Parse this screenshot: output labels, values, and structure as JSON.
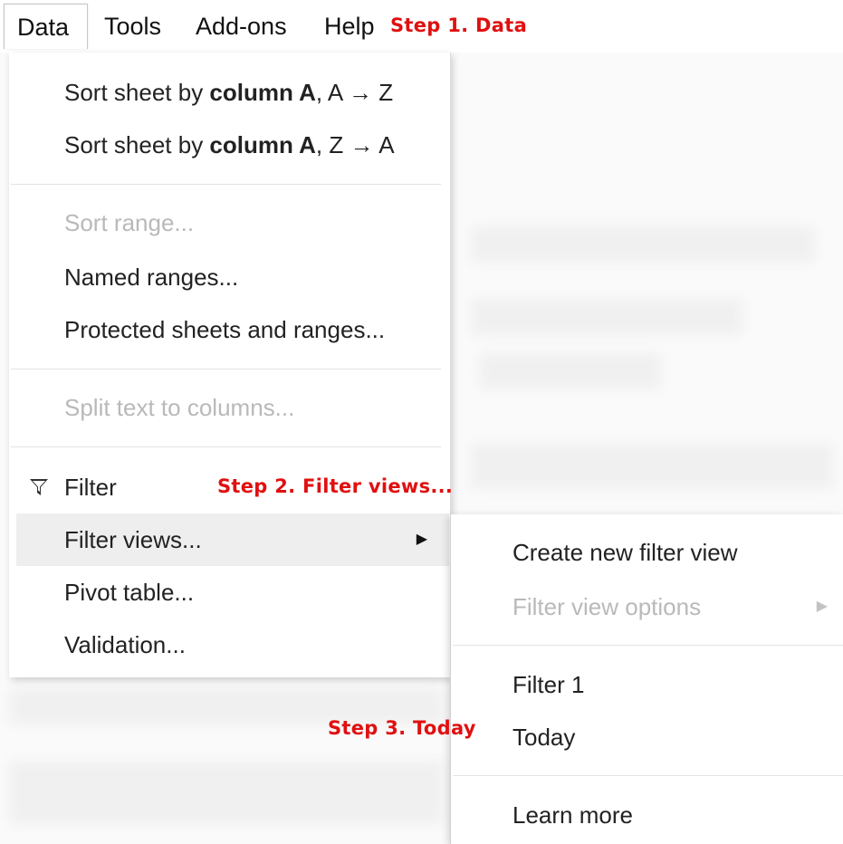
{
  "menubar": {
    "items": [
      "Data",
      "Tools",
      "Add-ons",
      "Help"
    ]
  },
  "annotations": {
    "step1": "Step 1. Data",
    "step2": "Step 2. Filter views...",
    "step3": "Step 3. Today"
  },
  "data_menu": {
    "sort_az": {
      "prefix": "Sort sheet by ",
      "bold": "column A",
      "suffix": ", A → Z"
    },
    "sort_za": {
      "prefix": "Sort sheet by ",
      "bold": "column A",
      "suffix": ", Z → A"
    },
    "sort_range": "Sort range...",
    "named_ranges": "Named ranges...",
    "protected": "Protected sheets and ranges...",
    "split_text": "Split text to columns...",
    "filter": "Filter",
    "filter_views": "Filter views...",
    "pivot_table": "Pivot table...",
    "validation": "Validation...",
    "submenu_arrow": "▶"
  },
  "filter_views_submenu": {
    "create": "Create new filter view",
    "options": "Filter view options",
    "filter1": "Filter 1",
    "today": "Today",
    "learn_more": "Learn more"
  },
  "icons": {
    "filter": "filter-funnel-icon",
    "submenu": "triangle-right-icon"
  },
  "colors": {
    "annotation": "#e01010",
    "disabled_text": "#b9b9b9",
    "highlight_bg": "#eeeeee"
  }
}
